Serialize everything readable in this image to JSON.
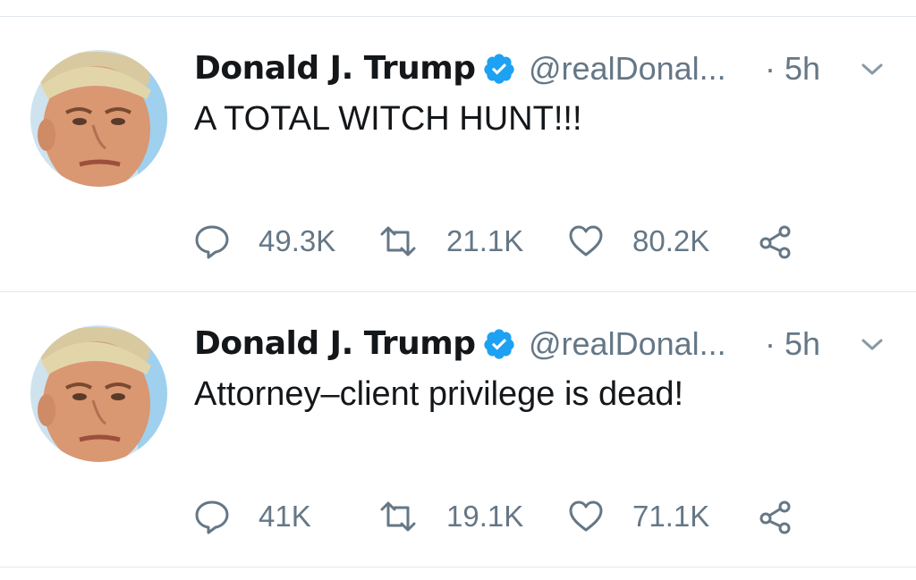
{
  "colors": {
    "text_primary": "#14171a",
    "text_secondary": "#657786",
    "verified_blue": "#1da1f2",
    "divider": "#e1e8ed"
  },
  "tweets": [
    {
      "author": "Donald J. Trump",
      "verified_icon": "verified-badge-icon",
      "handle": "@realDonal...",
      "time": "· 5h",
      "text": "A TOTAL WITCH HUNT!!!",
      "replies": "49.3K",
      "retweets": "21.1K",
      "likes": "80.2K"
    },
    {
      "author": "Donald J. Trump",
      "verified_icon": "verified-badge-icon",
      "handle": "@realDonal...",
      "time": "· 5h",
      "text": "Attorney–client privilege is dead!",
      "replies": "41K",
      "retweets": "19.1K",
      "likes": "71.1K"
    }
  ],
  "icons": {
    "reply": "reply-icon",
    "retweet": "retweet-icon",
    "like": "heart-icon",
    "share": "share-icon",
    "more": "chevron-down-icon"
  }
}
